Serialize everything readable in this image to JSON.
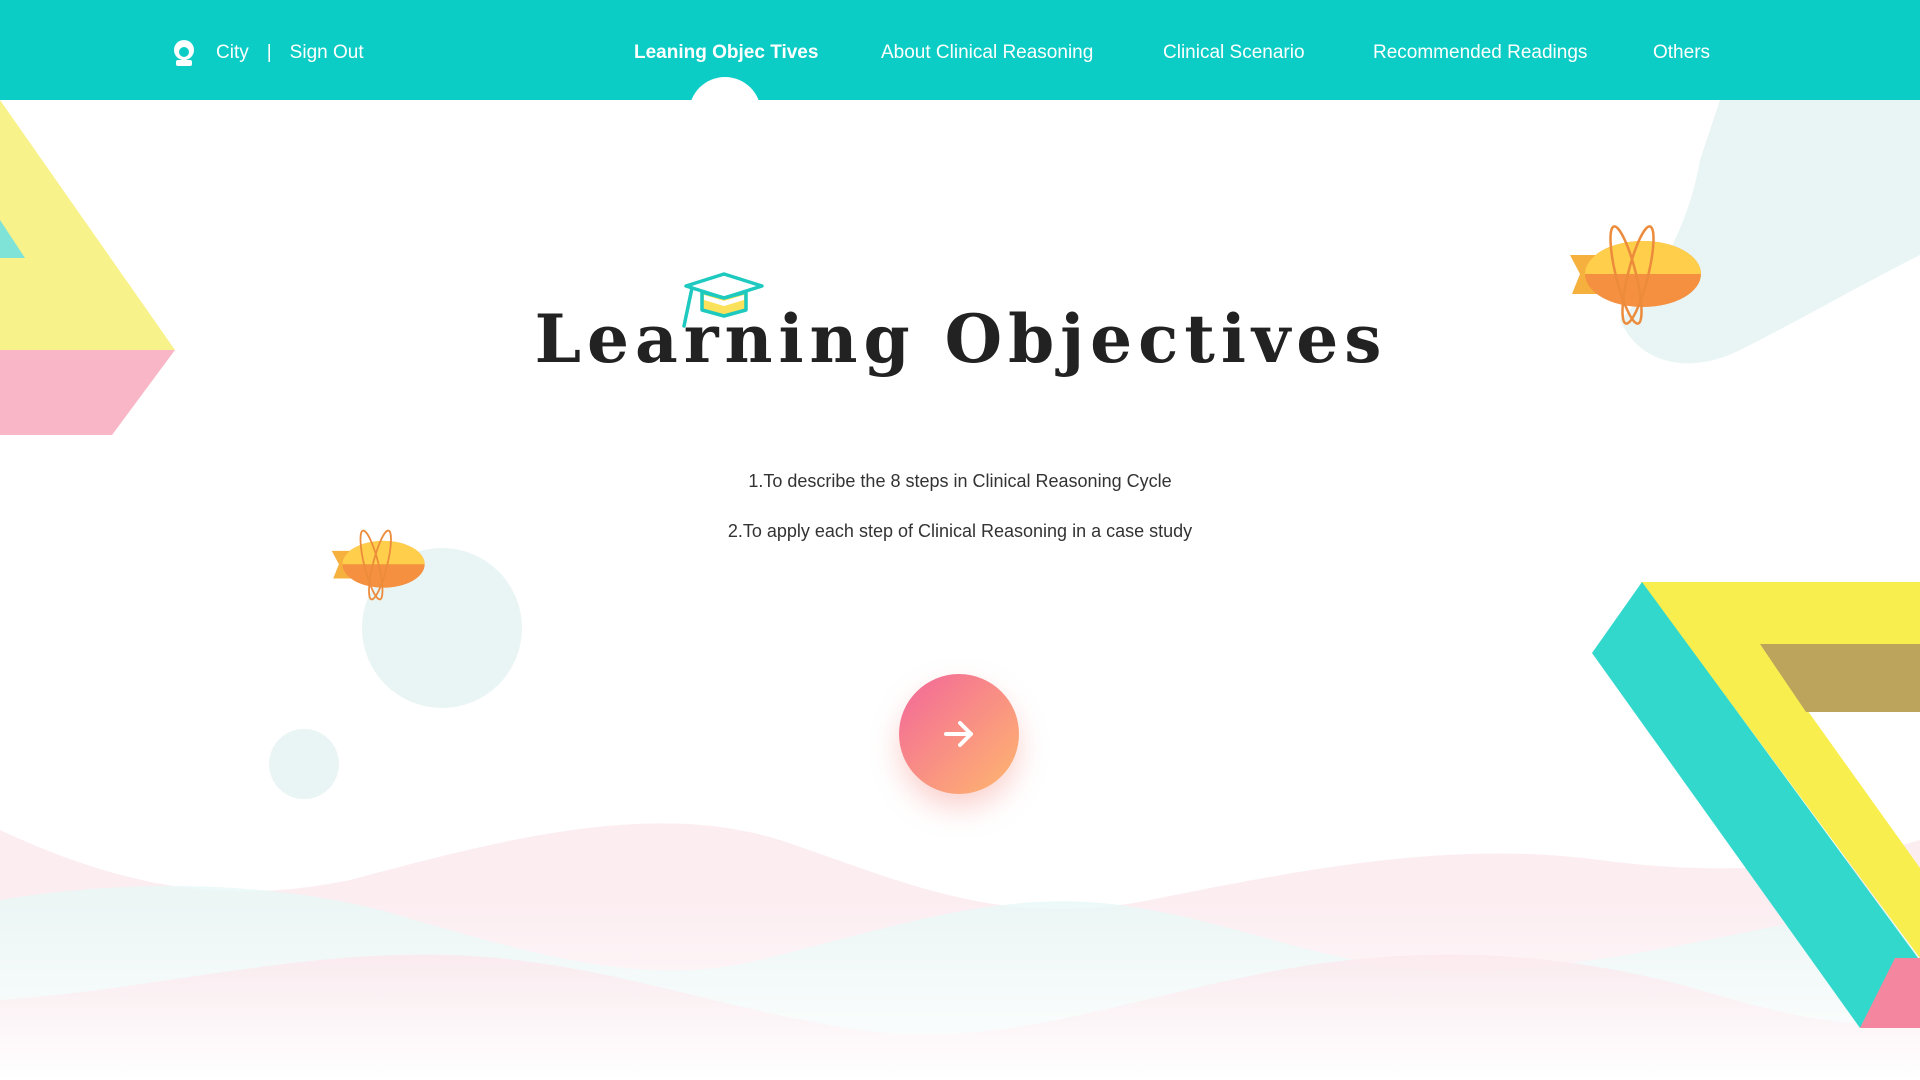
{
  "header": {
    "user": {
      "name": "City",
      "separator": "|",
      "sign_out": "Sign Out",
      "icon": "user-icon"
    },
    "nav": [
      {
        "label": "Leaning Objec Tives",
        "active": true
      },
      {
        "label": "About Clinical Reasoning",
        "active": false
      },
      {
        "label": "Clinical Scenario",
        "active": false
      },
      {
        "label": "Recommended Readings",
        "active": false
      },
      {
        "label": "Others",
        "active": false
      }
    ],
    "color": "#0ccdc5"
  },
  "main": {
    "title": "Learning Objectives",
    "title_icon": "graduation-cap-icon",
    "objectives": [
      "1.To describe the 8 steps in Clinical Reasoning Cycle",
      "2.To apply each step of Clinical Reasoning in a case study"
    ],
    "next_button_icon": "arrow-right-icon"
  },
  "colors": {
    "accent_teal": "#0ccdc5",
    "yellow": "#f8ef4f",
    "pink": "#f5869f",
    "button_gradient_start": "#f2669a",
    "button_gradient_end": "#ffb86e"
  }
}
